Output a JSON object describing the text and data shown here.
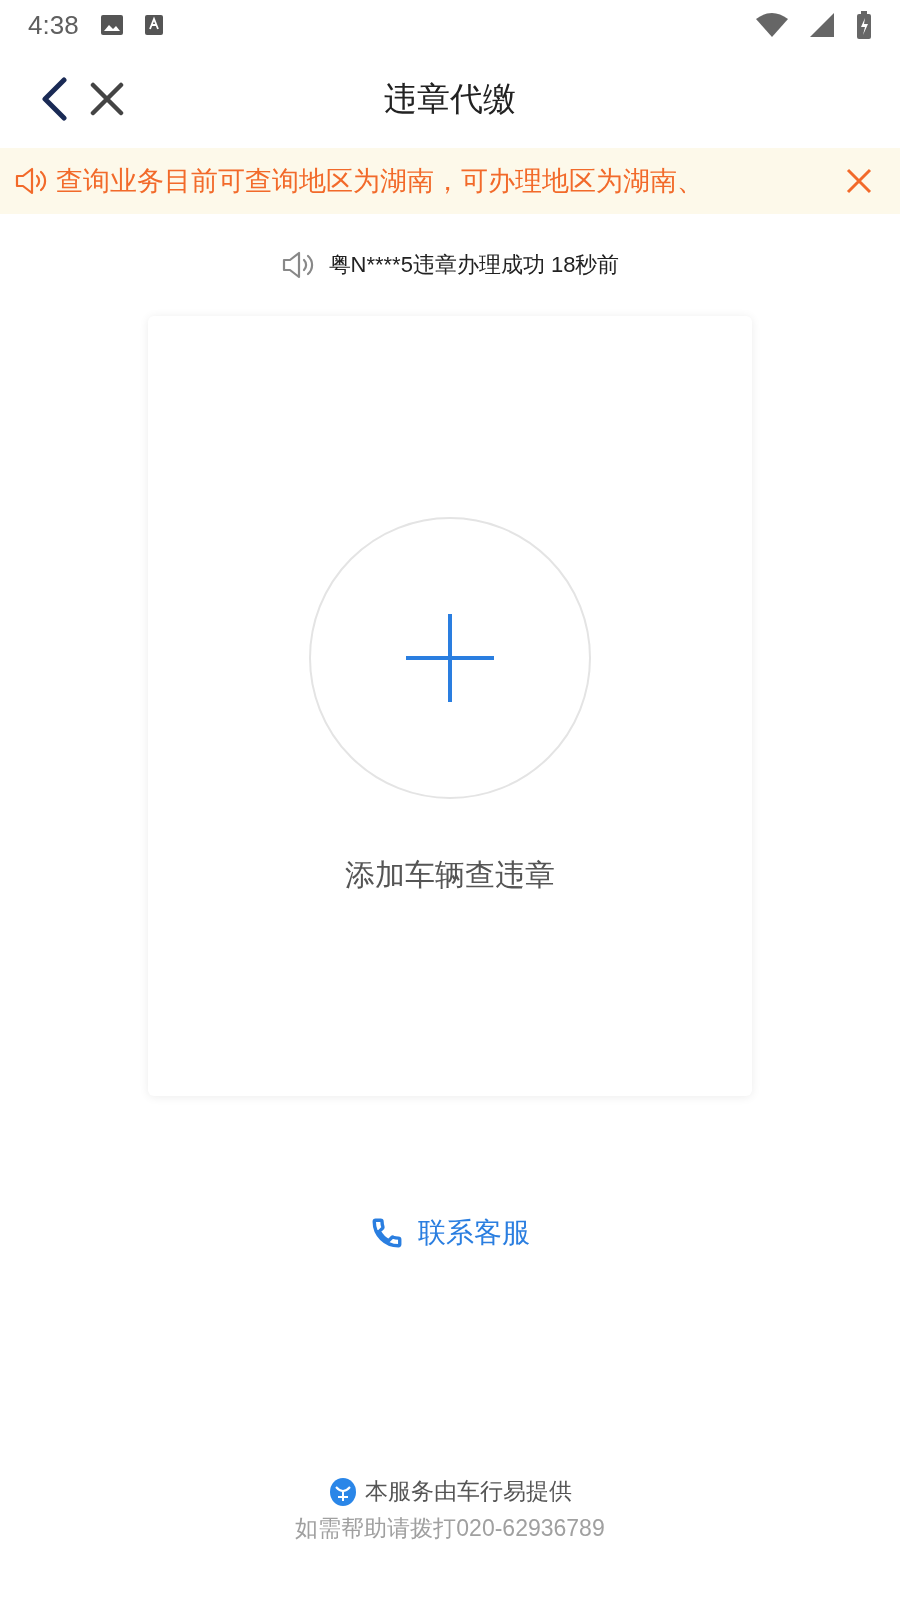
{
  "status_bar": {
    "time": "4:38"
  },
  "header": {
    "title": "违章代缴"
  },
  "notice": {
    "text": "查询业务目前可查询地区为湖南，可办理地区为湖南、",
    "closable": true
  },
  "ticker": {
    "text": "粤N****5违章办理成功 18秒前"
  },
  "add_card": {
    "label": "添加车辆查违章"
  },
  "contact": {
    "label": "联系客服"
  },
  "footer": {
    "provider": "本服务由车行易提供",
    "help": "如需帮助请拨打020-62936789"
  }
}
